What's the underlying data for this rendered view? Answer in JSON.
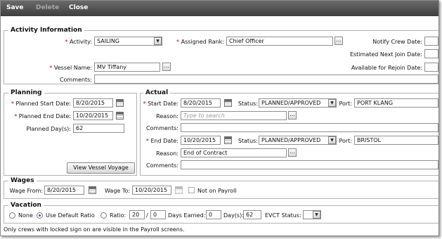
{
  "toolbar": {
    "save": "Save",
    "delete": "Delete",
    "close": "Close"
  },
  "activity": {
    "legend": "Activity Information",
    "activity_label": "Activity:",
    "activity_value": "SAILING",
    "assigned_rank_label": "Assigned Rank:",
    "assigned_rank_value": "Chief Officer",
    "notify_crew_label": "Notify Crew Date:",
    "notify_crew_value": "",
    "est_next_join_label": "Estimated Next Join Date:",
    "est_next_join_value": "",
    "vessel_name_label": "Vessel Name:",
    "vessel_name_value": "MV Tiffany",
    "available_rejoin_label": "Available for Rejoin Date:",
    "available_rejoin_value": "",
    "comments_label": "Comments:",
    "comments_value": ""
  },
  "planning": {
    "legend": "Planning",
    "start_label": "Planned Start Date:",
    "start_value": "8/20/2015",
    "end_label": "Planned End Date:",
    "end_value": "10/20/2015",
    "days_label": "Planned Day(s):",
    "days_value": "62",
    "view_voyage": "View Vessel Voyage"
  },
  "actual": {
    "legend": "Actual",
    "start_label": "Start Date:",
    "start_value": "8/20/2015",
    "status_label": "Status:",
    "start_status": "PLANNED/APPROVED",
    "port_label": "Port:",
    "start_port": "PORT KLANG",
    "reason_label": "Reason:",
    "start_reason_placeholder": "Type to search",
    "comments_label": "Comments:",
    "start_comments": "",
    "end_label": "End Date:",
    "end_value": "10/20/2015",
    "end_status": "PLANNED/APPROVED",
    "end_port": "BRISTOL",
    "end_reason": "End of Contract",
    "end_comments": ""
  },
  "wages": {
    "legend": "Wages",
    "from_label": "Wage From:",
    "from_value": "8/20/2015",
    "to_label": "Wage To:",
    "to_value": "10/20/2015",
    "not_on_payroll": "Not on Payroll"
  },
  "vacation": {
    "legend": "Vacation",
    "none": "None",
    "default_ratio": "Use Default Ratio",
    "ratio": "Ratio:",
    "ratio_a": "20",
    "ratio_sep": "/",
    "ratio_b": "0",
    "days_earned_label": "Days Earned:",
    "days_earned_value": "0",
    "days_label": "Day(s):",
    "days_value": "62",
    "evct_label": "EVCT Status:",
    "evct_value": ""
  },
  "footer": "Only crews with locked sign on are visible in the Payroll screens.",
  "colors": {
    "toolbar_top": "#6a6a6a",
    "toolbar_bottom": "#3e3e3e",
    "required": "#c00000"
  },
  "icons": [
    "ellipsis-icon",
    "calendar-icon",
    "dropdown-arrow-icon"
  ]
}
